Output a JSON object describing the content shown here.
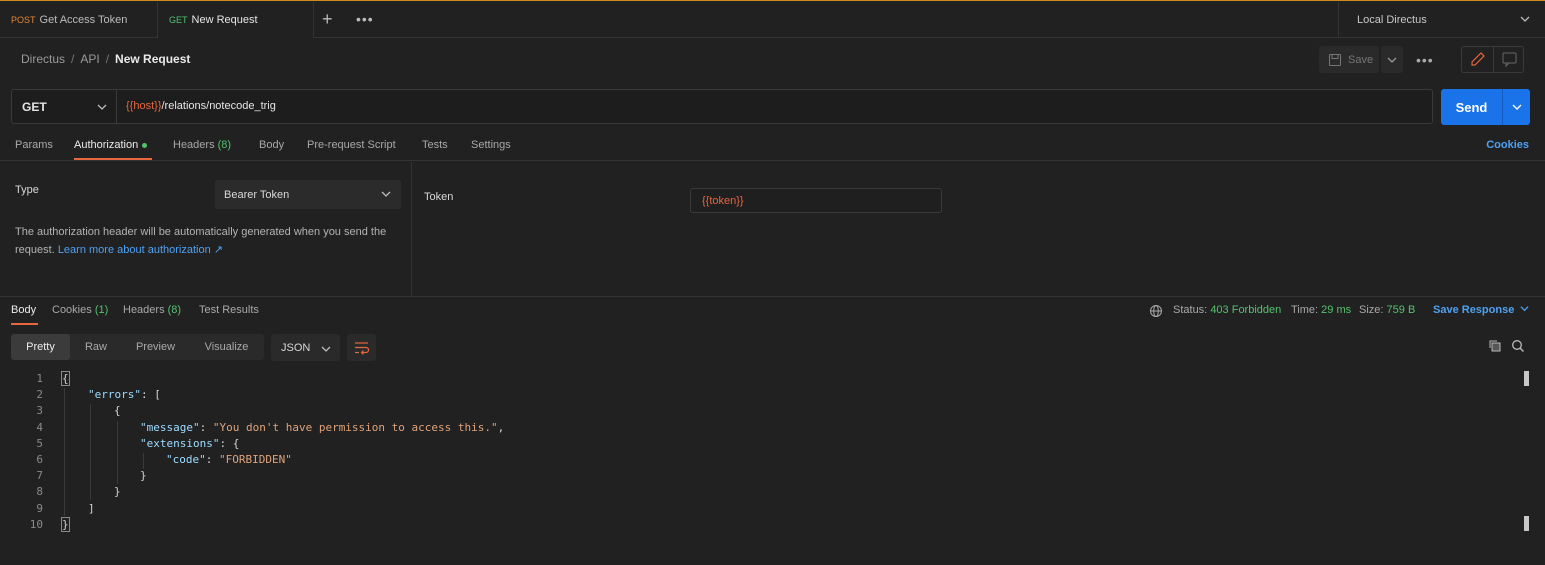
{
  "tabs": [
    {
      "method": "POST",
      "label": "Get Access Token"
    },
    {
      "method": "GET",
      "label": "New Request"
    }
  ],
  "environment": "Local Directus",
  "breadcrumb": [
    "Directus",
    "API",
    "New Request"
  ],
  "toolbar": {
    "save_label": "Save"
  },
  "request": {
    "method": "GET",
    "url_var": "{{host}}",
    "url_path": "/relations/notecode_trig",
    "send_label": "Send"
  },
  "request_tabs": {
    "params": "Params",
    "authorization": "Authorization",
    "headers": "Headers",
    "headers_count": "(8)",
    "body": "Body",
    "prerequest": "Pre-request Script",
    "tests": "Tests",
    "settings": "Settings",
    "cookies": "Cookies"
  },
  "auth": {
    "type_label": "Type",
    "type_value": "Bearer Token",
    "description": "The authorization header will be automatically generated when you send the request.",
    "learn_more": "Learn more about authorization ↗",
    "token_label": "Token",
    "token_value": "{{token}}"
  },
  "response_tabs": {
    "body": "Body",
    "cookies": "Cookies",
    "cookies_count": "(1)",
    "headers": "Headers",
    "headers_count": "(8)",
    "test_results": "Test Results"
  },
  "response_status": {
    "status_label": "Status:",
    "status_value": "403 Forbidden",
    "time_label": "Time:",
    "time_value": "29 ms",
    "size_label": "Size:",
    "size_value": "759 B",
    "save_response": "Save Response"
  },
  "view_modes": [
    "Pretty",
    "Raw",
    "Preview",
    "Visualize"
  ],
  "active_view": "Pretty",
  "format": "JSON",
  "code": {
    "line_numbers": [
      "1",
      "2",
      "3",
      "4",
      "5",
      "6",
      "7",
      "8",
      "9",
      "10"
    ],
    "open_brace": "{",
    "close_brace": "}",
    "errors_key": "\"errors\"",
    "open_bracket": "[",
    "close_bracket": "]",
    "message_key": "\"message\"",
    "message_value": "\"You don't have permission to access this.\"",
    "extensions_key": "\"extensions\"",
    "code_key": "\"code\"",
    "code_value": "\"FORBIDDEN\""
  },
  "colors": {
    "accent_orange": "#e8663d",
    "send_blue": "#1a73e8",
    "status_green": "#53c26d",
    "link_blue": "#4ea1f3"
  }
}
